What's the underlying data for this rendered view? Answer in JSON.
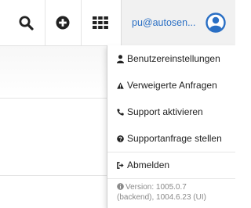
{
  "header": {
    "search_icon": "search-icon",
    "add_icon": "plus-circle-icon",
    "apps_icon": "grid-icon",
    "user_email": "pu@autosen...",
    "user_icon": "user-circle-icon"
  },
  "menu": {
    "items": [
      {
        "label": "Benutzereinstellungen",
        "icon": "user-icon"
      },
      {
        "label": "Verweigerte Anfragen",
        "icon": "warning-icon"
      },
      {
        "label": "Support aktivieren",
        "icon": "phone-icon"
      },
      {
        "label": "Supportanfrage stellen",
        "icon": "question-circle-icon"
      },
      {
        "label": "Abmelden",
        "icon": "sign-out-icon"
      }
    ],
    "version_line1": "Version: 1005.0.7",
    "version_line2": "(backend), 1004.6.23 (UI)",
    "version_icon": "info-circle-icon"
  },
  "colors": {
    "accent": "#2a6fc4",
    "icon_dark": "#222222",
    "muted": "#8a8a8a"
  }
}
